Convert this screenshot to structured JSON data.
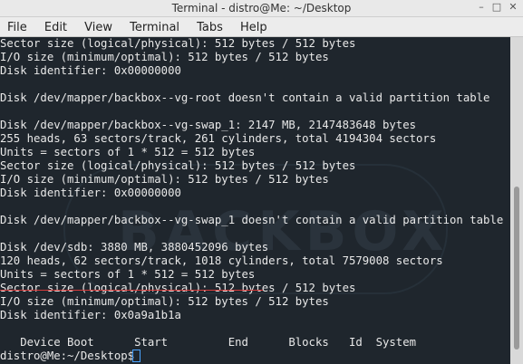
{
  "window": {
    "title": "Terminal - distro@Me: ~/Desktop"
  },
  "menu": [
    "File",
    "Edit",
    "View",
    "Terminal",
    "Tabs",
    "Help"
  ],
  "terminal": {
    "lines": [
      "Sector size (logical/physical): 512 bytes / 512 bytes",
      "I/O size (minimum/optimal): 512 bytes / 512 bytes",
      "Disk identifier: 0x00000000",
      "",
      "Disk /dev/mapper/backbox--vg-root doesn't contain a valid partition table",
      "",
      "Disk /dev/mapper/backbox--vg-swap_1: 2147 MB, 2147483648 bytes",
      "255 heads, 63 sectors/track, 261 cylinders, total 4194304 sectors",
      "Units = sectors of 1 * 512 = 512 bytes",
      "Sector size (logical/physical): 512 bytes / 512 bytes",
      "I/O size (minimum/optimal): 512 bytes / 512 bytes",
      "Disk identifier: 0x00000000",
      "",
      "Disk /dev/mapper/backbox--vg-swap_1 doesn't contain a valid partition table",
      "",
      "Disk /dev/sdb: 3880 MB, 3880452096 bytes",
      "120 heads, 62 sectors/track, 1018 cylinders, total 7579008 sectors",
      "Units = sectors of 1 * 512 = 512 bytes",
      "Sector size (logical/physical): 512 bytes / 512 bytes",
      "I/O size (minimum/optimal): 512 bytes / 512 bytes",
      "Disk identifier: 0x0a9a1b1a",
      "",
      "   Device Boot      Start         End      Blocks   Id  System",
      "distro@Me:~/Desktop$ "
    ],
    "watermark": "BACKBOX"
  },
  "colors": {
    "terminal_bg": "#1f262d",
    "text": "#e8e8e8",
    "underline": "#d53a3a",
    "cursor": "#4aa3ff"
  }
}
